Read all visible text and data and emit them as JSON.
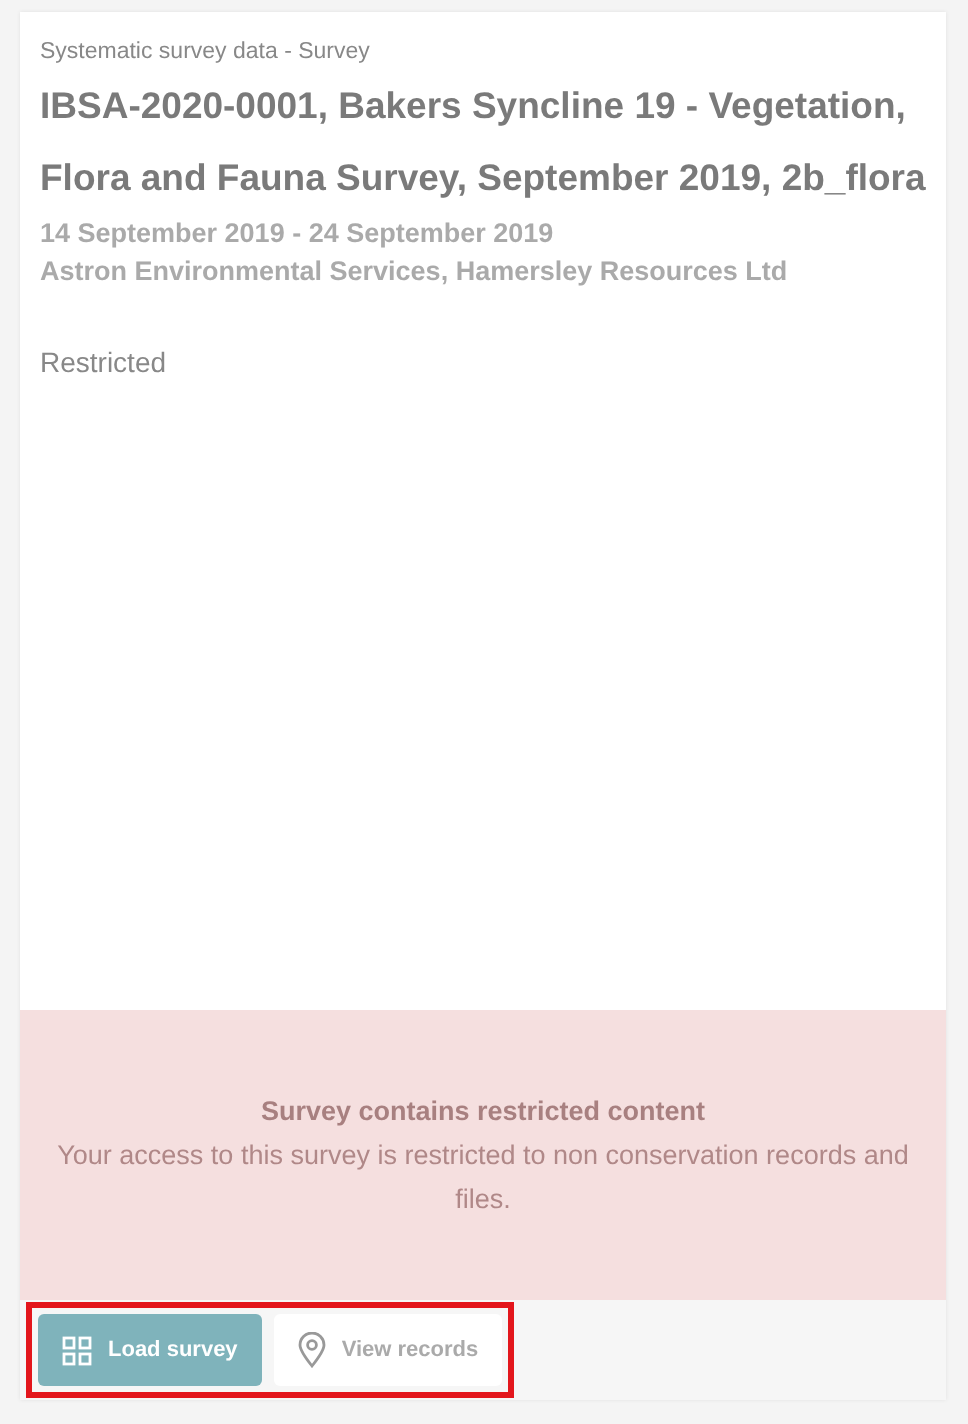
{
  "card": {
    "category": "Systematic survey data - Survey",
    "title": "IBSA-2020-0001, Bakers Syncline 19 - Vegetation, Flora and Fauna Survey, September 2019, 2b_flora",
    "dates": "14 September 2019 - 24 September 2019",
    "organisations": "Astron Environmental Services, Hamersley Resources Ltd",
    "access": "Restricted",
    "restriction": {
      "title": "Survey contains restricted content",
      "message": "Your access to this survey is restricted to non conservation records and files."
    },
    "actions": {
      "highlighted": true,
      "buttons": [
        {
          "label": "Load survey",
          "kind": "primary"
        },
        {
          "label": "View records",
          "kind": "secondary"
        }
      ]
    }
  }
}
